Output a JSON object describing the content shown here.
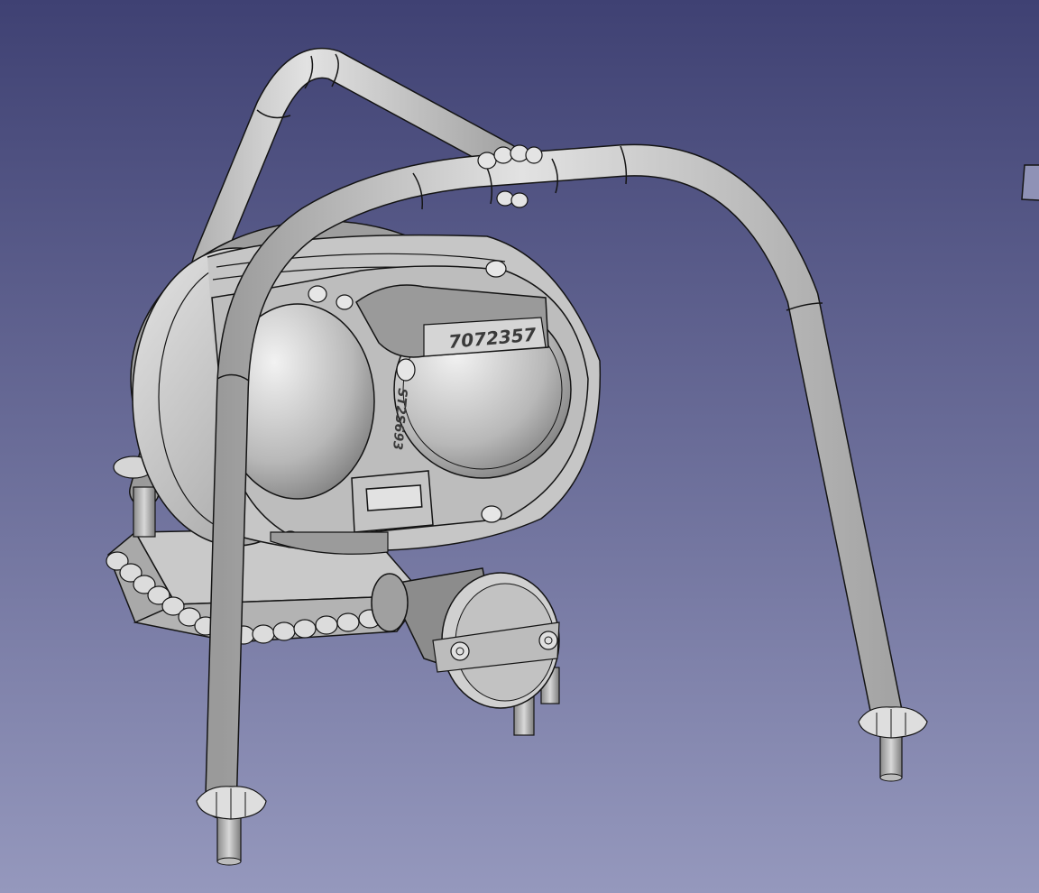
{
  "viewport": {
    "background_top": "#3f4173",
    "background_bottom": "#9598bd"
  },
  "model": {
    "plate_text": "7072357",
    "side_text": "ST2S693",
    "surface_color": "#d2d2d2",
    "edge_color": "#141414"
  }
}
